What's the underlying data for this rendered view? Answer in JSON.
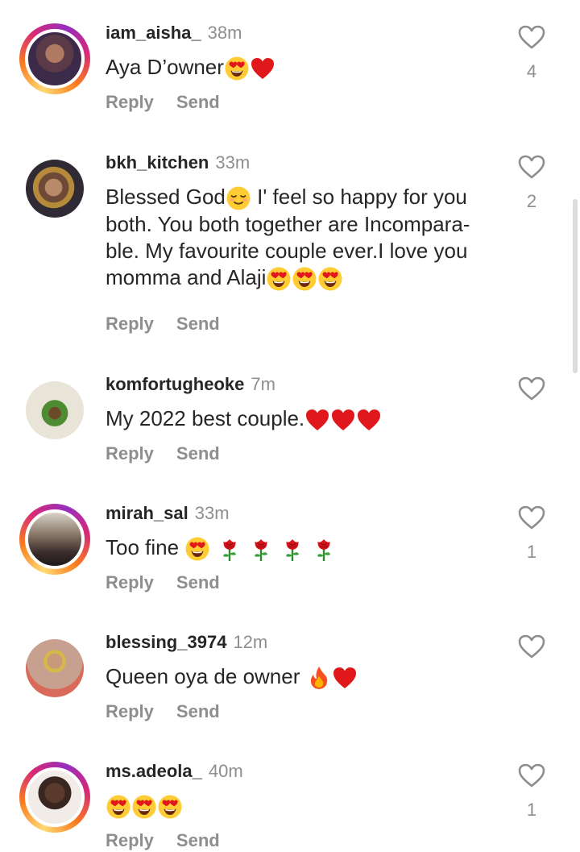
{
  "comments": [
    {
      "username": "iam_aisha_",
      "time": "38m",
      "text": "Aya D’owner",
      "emojis": [
        "heart-eyes",
        "red-heart"
      ],
      "reply": "Reply",
      "send": "Send",
      "likes": "4",
      "ring": true
    },
    {
      "username": "bkh_kitchen",
      "time": "33m",
      "text_lines": [
        "Blessed God",
        "both. You both together are Incompara-",
        "ble. My favourite couple ever.I love you",
        "momma and Alaji"
      ],
      "line1_tail": " I' feel so happy for you",
      "emojis": [
        "relieved",
        "heart-eyes",
        "heart-eyes",
        "heart-eyes"
      ],
      "reply": "Reply",
      "send": "Send",
      "likes": "2",
      "ring": false
    },
    {
      "username": "komfortugheoke",
      "time": "7m",
      "text": "My 2022 best couple.",
      "emojis": [
        "red-heart",
        "red-heart",
        "red-heart"
      ],
      "reply": "Reply",
      "send": "Send",
      "likes": "",
      "ring": false
    },
    {
      "username": "mirah_sal",
      "time": "33m",
      "text": "Too fine ",
      "emojis": [
        "heart-eyes",
        "rose",
        "rose",
        "rose",
        "rose"
      ],
      "reply": "Reply",
      "send": "Send",
      "likes": "1",
      "ring": true
    },
    {
      "username": "blessing_3974",
      "time": "12m",
      "text": "Queen oya de owner ",
      "emojis": [
        "fire",
        "red-heart"
      ],
      "reply": "Reply",
      "send": "Send",
      "likes": "",
      "ring": false
    },
    {
      "username": "ms.adeola_",
      "time": "40m",
      "text": "",
      "emojis": [
        "heart-eyes",
        "heart-eyes",
        "heart-eyes"
      ],
      "reply": "Reply",
      "send": "Send",
      "likes": "1",
      "ring": true
    }
  ],
  "colors": {
    "text": "#262626",
    "muted": "#8e8e8e",
    "heart": "#e0181b",
    "emoji_face": "#ffcc33"
  }
}
